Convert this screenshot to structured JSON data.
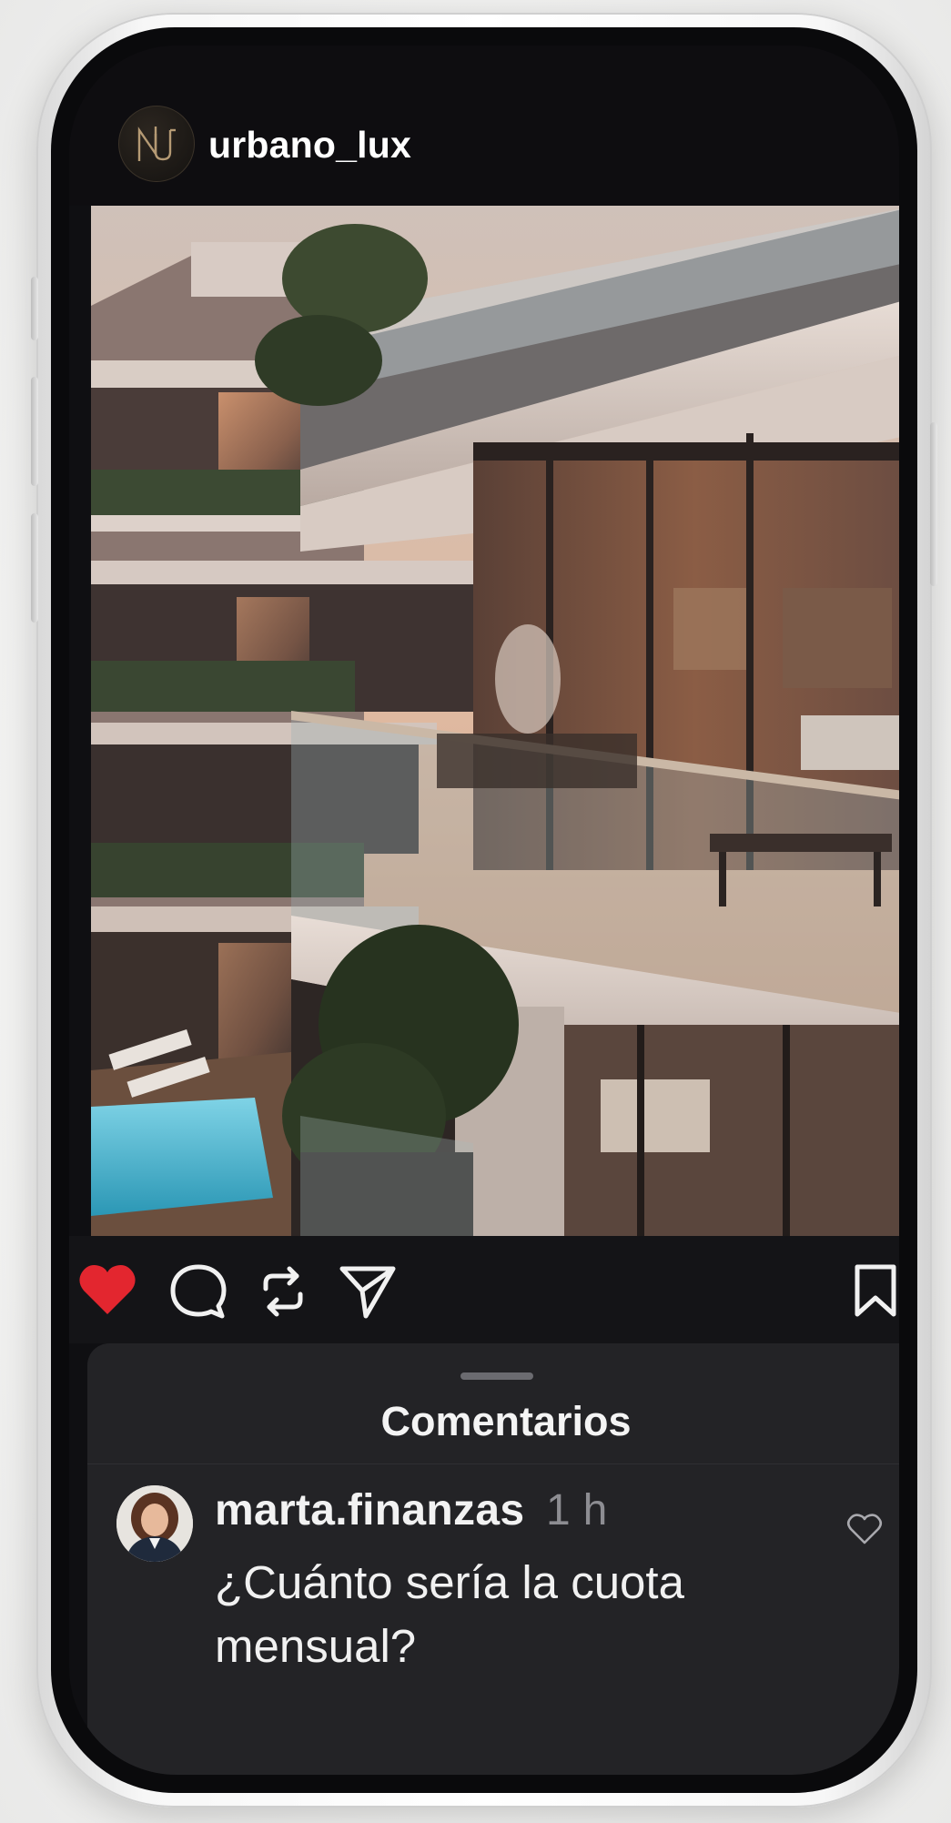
{
  "profile": {
    "username": "urbano_lux",
    "logo_icon": "monogram-logo-icon"
  },
  "post": {
    "image_description_icon": "building-photo",
    "liked": true
  },
  "actions": {
    "like_icon": "heart-filled-icon",
    "comment_icon": "comment-bubble-icon",
    "repost_icon": "repost-icon",
    "share_icon": "send-icon",
    "save_icon": "bookmark-icon",
    "like_color": "#e3262f"
  },
  "comments_sheet": {
    "title": "Comentarios",
    "comments": [
      {
        "username": "marta.finanzas",
        "time": "1 h",
        "text": "¿Cuánto sería la cuota mensual?",
        "like_icon": "heart-outline-icon"
      }
    ]
  }
}
